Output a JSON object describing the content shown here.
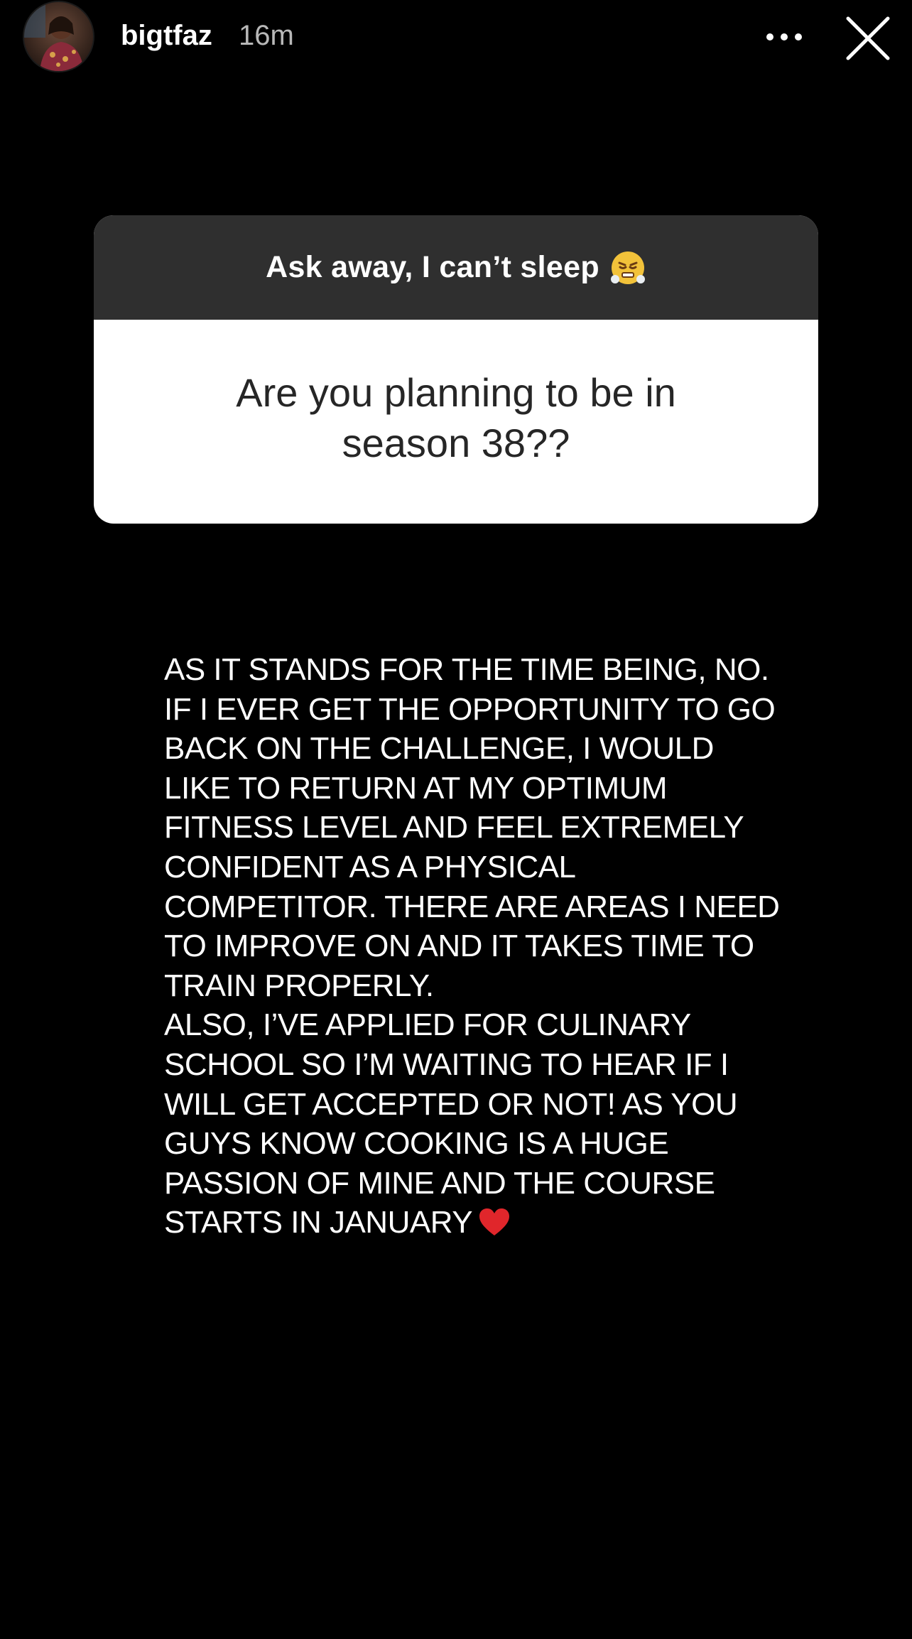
{
  "header": {
    "username": "bigtfaz",
    "timestamp": "16m",
    "more_icon": "ellipsis-icon",
    "close_icon": "close-icon"
  },
  "question_sticker": {
    "prompt": "Ask away, I can’t sleep",
    "prompt_emoji": "huffing-face-emoji",
    "question": "Are you planning to be in season 38??"
  },
  "answer": {
    "lines": [
      "AS IT STANDS FOR THE TIME BEING, NO.",
      "IF I EVER GET THE OPPORTUNITY TO GO",
      "BACK ON THE CHALLENGE, I WOULD",
      "LIKE TO RETURN AT MY OPTIMUM",
      "FITNESS LEVEL AND FEEL EXTREMELY",
      "CONFIDENT AS A PHYSICAL",
      "COMPETITOR. THERE ARE AREAS I NEED",
      "TO IMPROVE ON AND IT TAKES TIME TO",
      "TRAIN PROPERLY.",
      "ALSO, I’VE APPLIED FOR CULINARY",
      "SCHOOL SO I’M WAITING TO HEAR IF I",
      "WILL GET ACCEPTED OR NOT! AS YOU",
      "GUYS KNOW COOKING IS A HUGE",
      "PASSION OF MINE AND THE COURSE",
      "STARTS IN JANUARY"
    ],
    "trailing_emoji": "red-heart-icon"
  },
  "colors": {
    "background": "#000000",
    "card_header": "#2f2f2f",
    "card_body": "#ffffff",
    "question_text": "#262626",
    "heart": "#e0262b"
  }
}
